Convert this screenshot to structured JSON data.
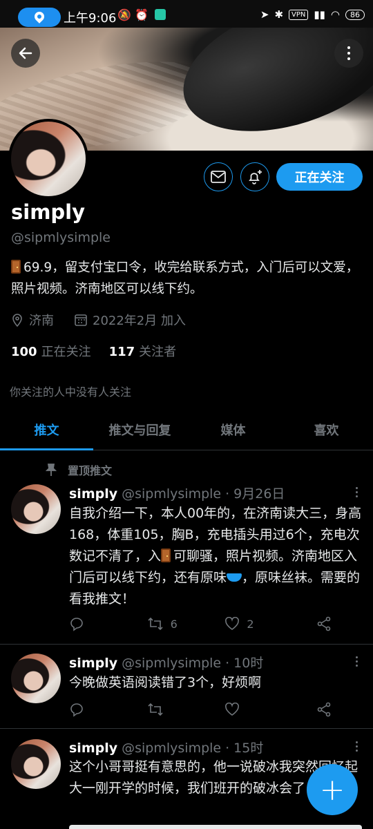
{
  "status_bar": {
    "time": "上午9:06",
    "vpn": "VPN",
    "battery": "86",
    "icons_left": [
      "muted-bell-icon",
      "alarm-icon",
      "app-notification-icon"
    ],
    "icons_right": [
      "location-arrow-icon",
      "bluetooth-icon",
      "vpn-icon",
      "hd-signal-icon",
      "wifi-icon",
      "battery-icon"
    ]
  },
  "profile": {
    "name": "simply",
    "handle": "@sipmlysimple",
    "bio_text": "69.9，留支付宝口令，收完给联系方式，入门后可以文爱，照片视频。济南地区可以线下约。",
    "location": "济南",
    "joined": "2022年2月 加入",
    "following_count": "100",
    "following_label": "正在关注",
    "followers_count": "117",
    "followers_label": "关注者",
    "no_mutual": "你关注的人中没有人关注",
    "follow_button": "正在关注"
  },
  "tabs": [
    {
      "label": "推文",
      "active": true
    },
    {
      "label": "推文与回复",
      "active": false
    },
    {
      "label": "媒体",
      "active": false
    },
    {
      "label": "喜欢",
      "active": false
    }
  ],
  "pinned_label": "置顶推文",
  "tweets": [
    {
      "name": "simply",
      "handle": "@sipmlysimple",
      "time": "9月26日",
      "text_parts": [
        "自我介绍一下，本人00年的，在济南读大三，身高168，体重105，胸B，充电插头用过6个，充电次数记不清了，入",
        "可聊骚，照片视频。济南地区入门后可以线下约，还有原味",
        "，原味丝袜。需要的看我推文！"
      ],
      "retweets": "6",
      "likes": "2"
    },
    {
      "name": "simply",
      "handle": "@sipmlysimple",
      "time": "10时",
      "text": "今晚做英语阅读错了3个，好烦啊",
      "retweets": "",
      "likes": ""
    },
    {
      "name": "simply",
      "handle": "@sipmlysimple",
      "time": "15时",
      "text": "这个小哥哥挺有意思的，他一说破冰我突然回忆起大一刚开学的时候，我们班开的破冰会了"
    }
  ],
  "colors": {
    "accent": "#1d9bf0",
    "secondary_text": "#71767b",
    "background": "#000000"
  }
}
